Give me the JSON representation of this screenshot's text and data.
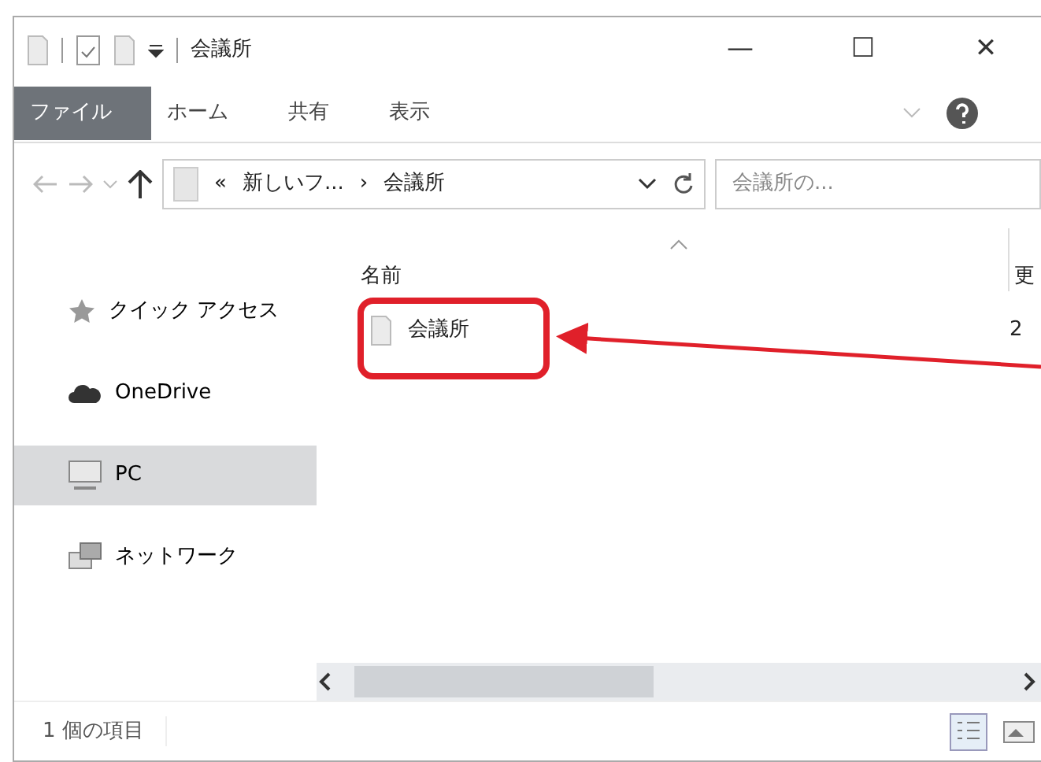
{
  "window": {
    "title": "会議所",
    "controls": [
      "—",
      "☐",
      "✕"
    ]
  },
  "ribbon": {
    "tabs": [
      {
        "label": "ファイル",
        "selected": true
      },
      {
        "label": "ホーム",
        "selected": false
      },
      {
        "label": "共有",
        "selected": false
      },
      {
        "label": "表示",
        "selected": false
      }
    ]
  },
  "address_bar": {
    "overflow": "«",
    "path": [
      "新しいフ...",
      "会議所"
    ],
    "separator": "›",
    "search_placeholder": "会議所の..."
  },
  "sidebar": {
    "items": [
      {
        "label": "クイック アクセス",
        "kind": "star",
        "selected": false
      },
      {
        "label": "OneDrive",
        "kind": "cloud",
        "selected": false
      },
      {
        "label": "PC",
        "kind": "monitor",
        "selected": true
      },
      {
        "label": "ネットワーク",
        "kind": "network",
        "selected": false
      }
    ]
  },
  "file_list": {
    "columns": [
      "名前",
      "更"
    ],
    "rows": [
      {
        "name": "会議所",
        "column_2": "2",
        "highlighted": true
      }
    ]
  },
  "status_bar": {
    "item_count": "1 個の項目"
  }
}
